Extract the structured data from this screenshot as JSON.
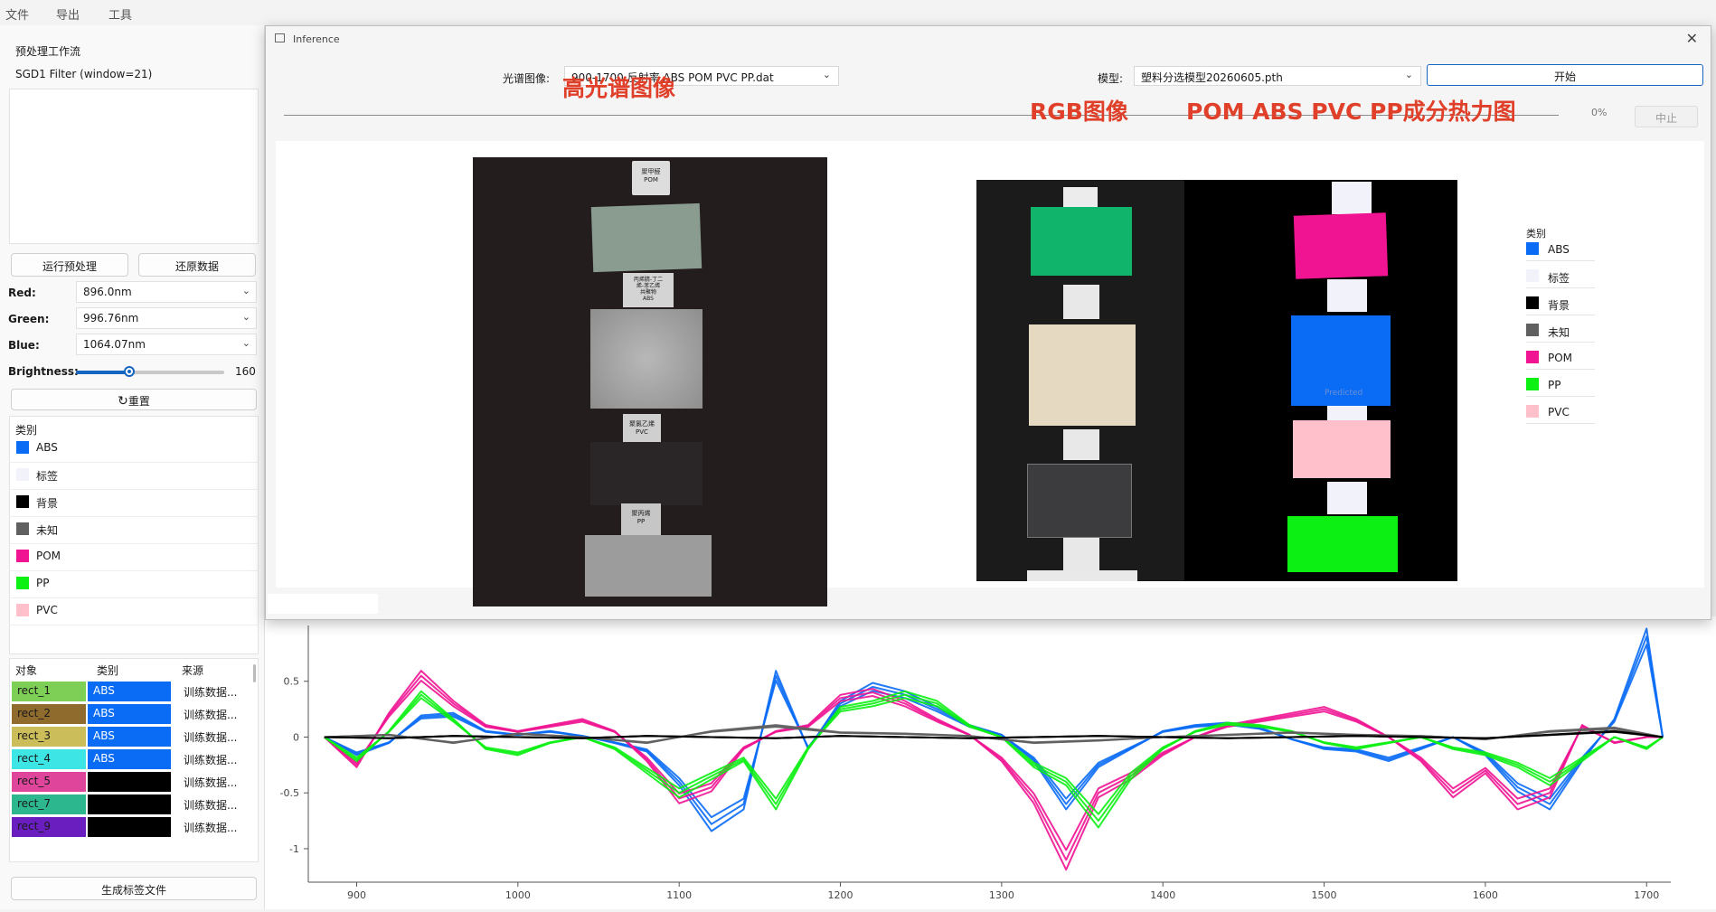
{
  "menubar": [
    "文件",
    "导出",
    "工具"
  ],
  "left": {
    "workflow_title": "预处理工作流",
    "workflow_items": [
      "SGD1 Filter (window=21)"
    ],
    "run_btn": "运行预处理",
    "restore_btn": "还原数据",
    "red_label": "Red:",
    "red_value": "896.0nm",
    "green_label": "Green:",
    "green_value": "996.76nm",
    "blue_label": "Blue:",
    "blue_value": "1064.07nm",
    "brightness_label": "Brightness:",
    "brightness_value": "160",
    "brightness_fraction": 0.36,
    "reset_btn": "重置",
    "class_header": "类别",
    "classes": [
      {
        "name": "ABS",
        "color": "#0a6cf5"
      },
      {
        "name": "标签",
        "color": "#f2f3fa"
      },
      {
        "name": "背景",
        "color": "#000000"
      },
      {
        "name": "未知",
        "color": "#606060"
      },
      {
        "name": "POM",
        "color": "#f01392"
      },
      {
        "name": "PP",
        "color": "#0cf013"
      },
      {
        "name": "PVC",
        "color": "#ffc0cb"
      }
    ],
    "table_headers": [
      "对象",
      "类别",
      "来源"
    ],
    "table_rows": [
      {
        "obj": "rect_1",
        "obj_color": "#7ecf55",
        "cls": "ABS",
        "cls_color": "#0a6cf5",
        "src": "训练数据..."
      },
      {
        "obj": "rect_2",
        "obj_color": "#8f6b2e",
        "cls": "ABS",
        "cls_color": "#0a6cf5",
        "src": "训练数据..."
      },
      {
        "obj": "rect_3",
        "obj_color": "#cbbd5a",
        "cls": "ABS",
        "cls_color": "#0a6cf5",
        "src": "训练数据..."
      },
      {
        "obj": "rect_4",
        "obj_color": "#3ee5e5",
        "cls": "ABS",
        "cls_color": "#0a6cf5",
        "src": "训练数据..."
      },
      {
        "obj": "rect_5",
        "obj_color": "#e0459c",
        "cls": "",
        "cls_color": "#000000",
        "src": "训练数据..."
      },
      {
        "obj": "rect_7",
        "obj_color": "#2db78e",
        "cls": "",
        "cls_color": "#000000",
        "src": "训练数据..."
      },
      {
        "obj": "rect_9",
        "obj_color": "#6a1ec0",
        "cls": "",
        "cls_color": "#000000",
        "src": "训练数据..."
      }
    ],
    "gen_btn": "生成标签文件"
  },
  "inference": {
    "window_title": "Inference",
    "spectral_label": "光谱图像:",
    "spectral_value": "900-1700 反射率 ABS POM PVC PP.dat",
    "model_label": "模型:",
    "model_value": "塑料分选模型20260605.pth",
    "start_btn": "开始",
    "progress_text": "0%",
    "progress_fraction": 0.0,
    "stop_btn": "中止",
    "title_hsi": "高光谱图像",
    "title_rgb": "RGB图像",
    "title_heatmap": "POM ABS PVC PP成分热力图",
    "hsi_labels": [
      [
        "聚甲醛",
        "POM"
      ],
      [
        "丙烯腈-丁二",
        "烯-苯乙烯",
        "共聚物",
        "ABS"
      ],
      [
        "聚氯乙烯",
        "PVC"
      ],
      [
        "聚丙烯",
        "PP"
      ]
    ],
    "predicted_text": "Predicted",
    "legend_header": "类别"
  },
  "chart_data": {
    "type": "line",
    "xlim": [
      870,
      1715
    ],
    "ylim": [
      -1.3,
      1.0
    ],
    "x_ticks": [
      900,
      1000,
      1100,
      1200,
      1300,
      1400,
      1500,
      1600,
      1700
    ],
    "y_ticks": [
      0.5,
      0,
      -0.5,
      -1
    ],
    "y_tick_labels": [
      "0.5",
      "0",
      "-0.5",
      "-1"
    ],
    "series": [
      {
        "color": "#0a6cf5",
        "x": [
          880,
          900,
          920,
          940,
          960,
          980,
          1000,
          1020,
          1040,
          1060,
          1080,
          1100,
          1120,
          1140,
          1160,
          1180,
          1200,
          1220,
          1240,
          1260,
          1280,
          1300,
          1320,
          1340,
          1360,
          1380,
          1400,
          1420,
          1440,
          1460,
          1480,
          1500,
          1520,
          1540,
          1560,
          1580,
          1600,
          1620,
          1640,
          1660,
          1680,
          1700,
          1710
        ],
        "y": [
          0,
          -0.15,
          -0.05,
          0.18,
          0.2,
          0.05,
          0.02,
          0.05,
          0.01,
          -0.05,
          -0.12,
          -0.4,
          -0.78,
          -0.6,
          0.55,
          -0.1,
          0.3,
          0.45,
          0.38,
          0.25,
          0.1,
          0.02,
          -0.2,
          -0.6,
          -0.25,
          -0.1,
          0.05,
          0.1,
          0.12,
          0.08,
          -0.02,
          -0.1,
          -0.12,
          -0.2,
          -0.1,
          0.0,
          -0.15,
          -0.45,
          -0.6,
          -0.2,
          0.15,
          0.9,
          0.0
        ]
      },
      {
        "color": "#f01392",
        "x": [
          880,
          900,
          920,
          940,
          960,
          980,
          1000,
          1020,
          1040,
          1060,
          1080,
          1100,
          1120,
          1140,
          1160,
          1180,
          1200,
          1220,
          1240,
          1260,
          1280,
          1300,
          1320,
          1340,
          1360,
          1380,
          1400,
          1420,
          1440,
          1460,
          1480,
          1500,
          1520,
          1540,
          1560,
          1580,
          1600,
          1620,
          1640,
          1660,
          1680,
          1700,
          1710
        ],
        "y": [
          0,
          -0.25,
          0.2,
          0.55,
          0.3,
          0.1,
          0.05,
          0.1,
          0.15,
          0.05,
          -0.2,
          -0.55,
          -0.45,
          -0.1,
          0.05,
          0.1,
          0.35,
          0.4,
          0.3,
          0.15,
          0.02,
          -0.2,
          -0.55,
          -1.1,
          -0.5,
          -0.35,
          -0.15,
          0.0,
          0.1,
          0.15,
          0.2,
          0.25,
          0.15,
          0.0,
          -0.2,
          -0.5,
          -0.3,
          -0.6,
          -0.5,
          0.1,
          -0.05,
          0.0,
          0.0
        ]
      },
      {
        "color": "#0cf013",
        "x": [
          880,
          900,
          920,
          940,
          960,
          980,
          1000,
          1020,
          1040,
          1060,
          1080,
          1100,
          1120,
          1140,
          1160,
          1180,
          1200,
          1220,
          1240,
          1260,
          1280,
          1300,
          1320,
          1340,
          1360,
          1380,
          1400,
          1420,
          1440,
          1460,
          1480,
          1500,
          1520,
          1540,
          1560,
          1580,
          1600,
          1620,
          1640,
          1660,
          1680,
          1700,
          1710
        ],
        "y": [
          0,
          -0.2,
          0.05,
          0.38,
          0.15,
          -0.1,
          -0.15,
          -0.05,
          0.0,
          -0.1,
          -0.3,
          -0.5,
          -0.35,
          -0.2,
          -0.6,
          -0.1,
          0.25,
          0.3,
          0.38,
          0.3,
          0.1,
          0.0,
          -0.25,
          -0.4,
          -0.75,
          -0.35,
          -0.1,
          0.05,
          0.12,
          0.1,
          0.05,
          -0.05,
          -0.1,
          -0.05,
          0.0,
          -0.1,
          -0.15,
          -0.25,
          -0.4,
          -0.2,
          0.0,
          -0.1,
          0.0
        ]
      },
      {
        "color": "#606060",
        "x": [
          880,
          920,
          960,
          1000,
          1040,
          1080,
          1120,
          1160,
          1200,
          1240,
          1280,
          1320,
          1360,
          1400,
          1440,
          1480,
          1520,
          1560,
          1600,
          1640,
          1680,
          1710
        ],
        "y": [
          0,
          0.02,
          -0.05,
          0.03,
          0.0,
          -0.05,
          0.05,
          0.1,
          0.04,
          0.03,
          0.01,
          -0.05,
          -0.03,
          0.0,
          0.02,
          0.04,
          0.02,
          0.01,
          -0.02,
          0.05,
          0.08,
          0.0
        ]
      },
      {
        "color": "#000000",
        "x": [
          880,
          920,
          960,
          1000,
          1040,
          1080,
          1120,
          1160,
          1200,
          1240,
          1280,
          1320,
          1360,
          1400,
          1440,
          1480,
          1520,
          1560,
          1600,
          1640,
          1680,
          1710
        ],
        "y": [
          0,
          -0.01,
          0.01,
          0.0,
          -0.01,
          0.01,
          0.0,
          -0.01,
          0.01,
          0.0,
          -0.01,
          0.0,
          0.01,
          0.0,
          -0.01,
          0.0,
          0.01,
          0.0,
          -0.01,
          0.02,
          0.05,
          0.0
        ]
      }
    ]
  }
}
